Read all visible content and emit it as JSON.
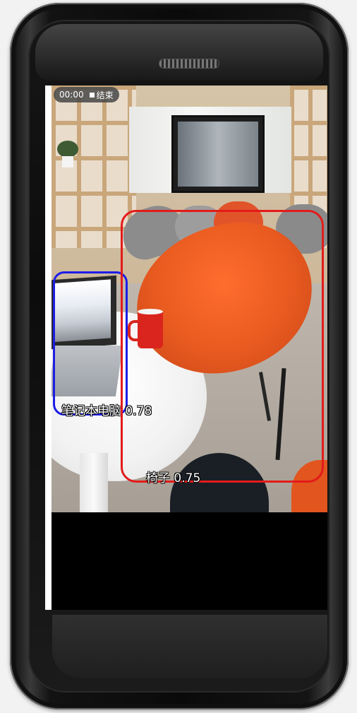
{
  "recording": {
    "time": "00:00",
    "end_label": "结束"
  },
  "detections": [
    {
      "label": "笔记本电脑",
      "score": "0.78",
      "color": "#1d1de6"
    },
    {
      "label": "椅子",
      "score": "0.75",
      "color": "#e31b1b"
    }
  ],
  "icons": {
    "stop": "stop-square-icon",
    "speaker": "earpiece-speaker-icon"
  }
}
